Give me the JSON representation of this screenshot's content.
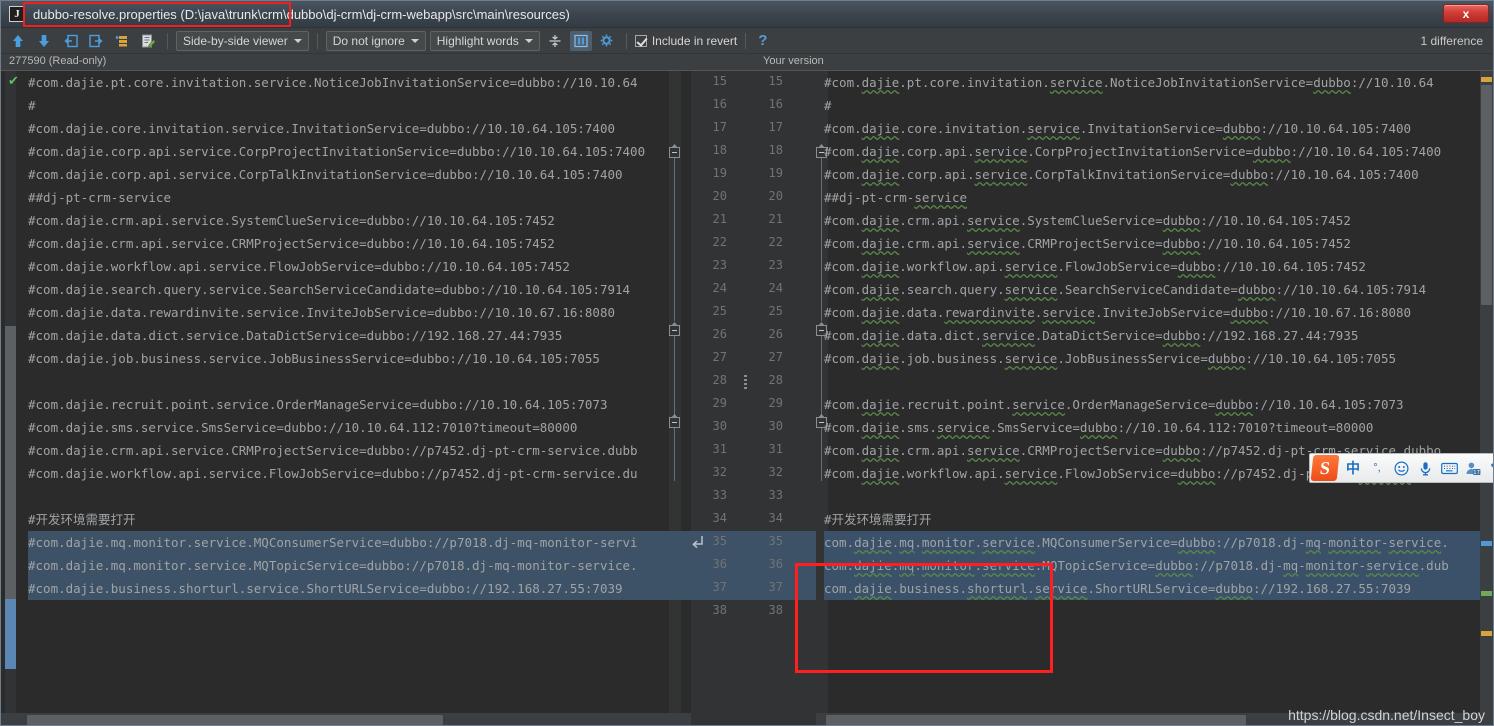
{
  "window": {
    "icon": "idea-file-icon",
    "title": "dubbo-resolve.properties (D:\\java\\trunk\\crm\\dubbo\\dj-crm\\dj-crm-webapp\\src\\main\\resources)",
    "close_label": "x"
  },
  "toolbar": {
    "icons": [
      {
        "name": "previous-difference-icon",
        "glyph": "arrow-up"
      },
      {
        "name": "next-difference-icon",
        "glyph": "arrow-down"
      },
      {
        "name": "apply-left-icon",
        "glyph": "arrow-left-box"
      },
      {
        "name": "apply-right-icon",
        "glyph": "arrow-right-box"
      },
      {
        "name": "revert-icon",
        "glyph": "stack"
      },
      {
        "name": "edit-source-icon",
        "glyph": "pencil-page"
      }
    ],
    "viewer_mode": "Side-by-side viewer",
    "ignore_policy": "Do not ignore",
    "highlight_mode": "Highlight words",
    "collapse_label": "collapse-unchanged-icon",
    "synchronize_label": "synchronize-scrolling-icon",
    "settings_label": "gear-icon",
    "include_in_revert": "Include in revert",
    "help": "?",
    "difference_count": "1 difference"
  },
  "panes": {
    "left_header": "277590 (Read-only)",
    "right_header": "Your version"
  },
  "gutter": {
    "line_numbers": [
      15,
      16,
      17,
      18,
      19,
      20,
      21,
      22,
      23,
      24,
      25,
      26,
      27,
      28,
      29,
      30,
      31,
      32,
      33,
      34,
      35,
      36,
      37,
      38
    ],
    "highlighted_lines": [
      35,
      36,
      37
    ],
    "apply_change_line": 35
  },
  "left_lines": [
    "#com.dajie.pt.core.invitation.service.NoticeJobInvitationService=dubbo://10.10.64",
    "#",
    "#com.dajie.core.invitation.service.InvitationService=dubbo://10.10.64.105:7400",
    "#com.dajie.corp.api.service.CorpProjectInvitationService=dubbo://10.10.64.105:7400",
    "#com.dajie.corp.api.service.CorpTalkInvitationService=dubbo://10.10.64.105:7400",
    "##dj-pt-crm-service",
    "#com.dajie.crm.api.service.SystemClueService=dubbo://10.10.64.105:7452",
    "#com.dajie.crm.api.service.CRMProjectService=dubbo://10.10.64.105:7452",
    "#com.dajie.workflow.api.service.FlowJobService=dubbo://10.10.64.105:7452",
    "#com.dajie.search.query.service.SearchServiceCandidate=dubbo://10.10.64.105:7914",
    "#com.dajie.data.rewardinvite.service.InviteJobService=dubbo://10.10.67.16:8080",
    "#com.dajie.data.dict.service.DataDictService=dubbo://192.168.27.44:7935",
    "#com.dajie.job.business.service.JobBusinessService=dubbo://10.10.64.105:7055",
    "",
    "#com.dajie.recruit.point.service.OrderManageService=dubbo://10.10.64.105:7073",
    "#com.dajie.sms.service.SmsService=dubbo://10.10.64.112:7010?timeout=80000",
    "#com.dajie.crm.api.service.CRMProjectService=dubbo://p7452.dj-pt-crm-service.dubb",
    "#com.dajie.workflow.api.service.FlowJobService=dubbo://p7452.dj-pt-crm-service.du",
    "",
    "#开发环境需要打开",
    "#com.dajie.mq.monitor.service.MQConsumerService=dubbo://p7018.dj-mq-monitor-servi",
    "#com.dajie.mq.monitor.service.MQTopicService=dubbo://p7018.dj-mq-monitor-service.",
    "#com.dajie.business.shorturl.service.ShortURLService=dubbo://192.168.27.55:7039",
    ""
  ],
  "right_lines": [
    "#com.dajie.pt.core.invitation.service.NoticeJobInvitationService=dubbo://10.10.64",
    "#",
    "#com.dajie.core.invitation.service.InvitationService=dubbo://10.10.64.105:7400",
    "#com.dajie.corp.api.service.CorpProjectInvitationService=dubbo://10.10.64.105:7400",
    "#com.dajie.corp.api.service.CorpTalkInvitationService=dubbo://10.10.64.105:7400",
    "##dj-pt-crm-service",
    "#com.dajie.crm.api.service.SystemClueService=dubbo://10.10.64.105:7452",
    "#com.dajie.crm.api.service.CRMProjectService=dubbo://10.10.64.105:7452",
    "#com.dajie.workflow.api.service.FlowJobService=dubbo://10.10.64.105:7452",
    "#com.dajie.search.query.service.SearchServiceCandidate=dubbo://10.10.64.105:7914",
    "#com.dajie.data.rewardinvite.service.InviteJobService=dubbo://10.10.67.16:8080",
    "#com.dajie.data.dict.service.DataDictService=dubbo://192.168.27.44:7935",
    "#com.dajie.job.business.service.JobBusinessService=dubbo://10.10.64.105:7055",
    "",
    "#com.dajie.recruit.point.service.OrderManageService=dubbo://10.10.64.105:7073",
    "#com.dajie.sms.service.SmsService=dubbo://10.10.64.112:7010?timeout=80000",
    "#com.dajie.crm.api.service.CRMProjectService=dubbo://p7452.dj-pt-crm-service.dubbo.",
    "#com.dajie.workflow.api.service.FlowJobService=dubbo://p7452.dj-pt-crm-service.dub",
    "",
    "#开发环境需要打开",
    "com.dajie.mq.monitor.service.MQConsumerService=dubbo://p7018.dj-mq-monitor-service.",
    "com.dajie.mq.monitor.service.MQTopicService=dubbo://p7018.dj-mq-monitor-service.dub",
    "com.dajie.business.shorturl.service.ShortURLService=dubbo://192.168.27.55:7039",
    ""
  ],
  "ime": {
    "logo": "sogou-logo-icon",
    "items": [
      {
        "name": "chinese-mode-icon",
        "glyph": "中"
      },
      {
        "name": "punctuation-mode-icon",
        "glyph": "°,"
      },
      {
        "name": "emoji-icon",
        "glyph": "☺"
      },
      {
        "name": "voice-input-icon",
        "glyph": "mic"
      },
      {
        "name": "soft-keyboard-icon",
        "glyph": "keyboard"
      },
      {
        "name": "user-center-icon",
        "glyph": "user-17"
      },
      {
        "name": "skin-icon",
        "glyph": "shirt"
      }
    ]
  },
  "watermark": "https://blog.csdn.net/Insect_boy",
  "colors": {
    "accent_blue": "#5b9bd5",
    "diff_highlight": "#3d5266",
    "annotation_red": "#ff1f1f",
    "background": "#2b2b2b",
    "chrome": "#3c3f41"
  }
}
